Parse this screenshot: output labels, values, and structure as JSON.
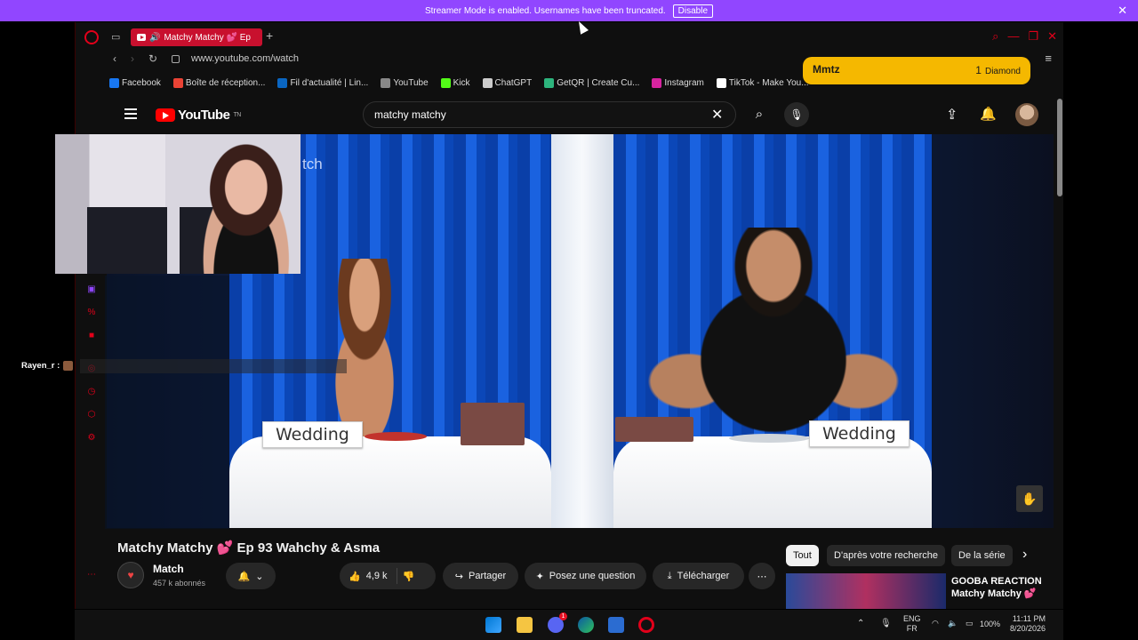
{
  "banner": {
    "text": "Streamer Mode is enabled. Usernames have been truncated.",
    "disable_label": "Disable"
  },
  "browser": {
    "tab_title": "Matchy Matchy 💕 Ep",
    "url": "www.youtube.com/watch",
    "bookmarks": [
      {
        "label": "Facebook",
        "icon": "facebook-icon",
        "color": "#1877f2"
      },
      {
        "label": "Boîte de réception...",
        "icon": "gmail-icon",
        "color": "#ea4335"
      },
      {
        "label": "Fil d'actualité | Lin...",
        "icon": "linkedin-icon",
        "color": "#0a66c2"
      },
      {
        "label": "YouTube",
        "icon": "page-icon",
        "color": "#888888"
      },
      {
        "label": "Kick",
        "icon": "kick-icon",
        "color": "#53fc18"
      },
      {
        "label": "ChatGPT",
        "icon": "chatgpt-icon",
        "color": "#cccccc"
      },
      {
        "label": "GetQR | Create Cu...",
        "icon": "getqr-icon",
        "color": "#2db47d"
      },
      {
        "label": "Instagram",
        "icon": "instagram-icon",
        "color": "#d6249f"
      },
      {
        "label": "TikTok - Make You...",
        "icon": "tiktok-icon",
        "color": "#ffffff"
      }
    ]
  },
  "youtube": {
    "logo_text": "YouTube",
    "logo_sup": "TN",
    "search_value": "matchy matchy",
    "video_watermark": "tch",
    "sign_left": "Wedding",
    "sign_right": "Wedding",
    "video_title": "Matchy Matchy 💕 Ep 93 Wahchy & Asma",
    "channel_name": "Match",
    "channel_subs": "457 k abonnés",
    "like_count": "4,9 k",
    "share_label": "Partager",
    "ask_label": "Posez une question",
    "download_label": "Télécharger",
    "chips": [
      "Tout",
      "D'après votre recherche",
      "De la série"
    ],
    "rec_title_1": "GOOBA REACTION",
    "rec_title_2": "Matchy Matchy 💕"
  },
  "overlay": {
    "chat_user": "Rayen_r :",
    "alert_name": "Mmtz",
    "alert_amount": "1",
    "alert_unit": "Diamond"
  },
  "taskbar": {
    "lang_1": "ENG",
    "lang_2": "FR",
    "battery": "100%",
    "time": "11:11 PM",
    "date": "8/20/2026",
    "discord_badge": "1"
  },
  "colors": {
    "banner": "#9146ff",
    "opera_red": "#e2001a",
    "alert": "#f5b800",
    "yt_red": "#ff0000"
  }
}
